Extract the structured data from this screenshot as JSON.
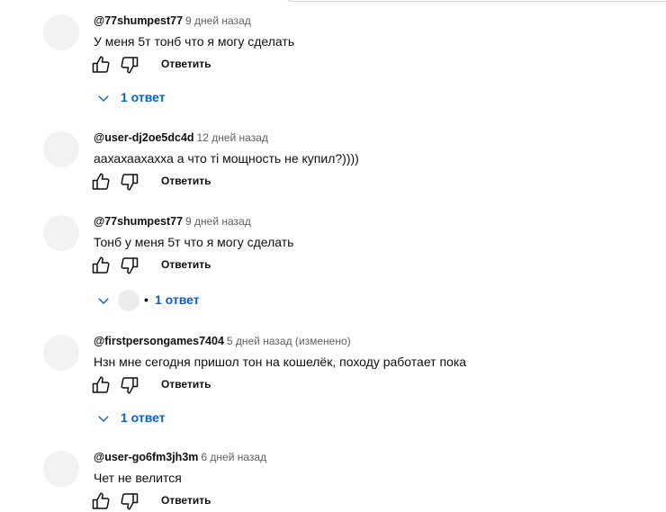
{
  "comments": [
    {
      "author": "@77shumpest77",
      "time": "9 дней назад",
      "text": "У меня 5т тонб что я могу сделать",
      "reply_label": "Ответить",
      "replies_label": "1 ответ"
    },
    {
      "author": "@user-dj2oe5dc4d",
      "time": "12 дней назад",
      "text": "аахахаахахха а что ті мощность не купил?))))",
      "reply_label": "Ответить"
    },
    {
      "author": "@77shumpest77",
      "time": "9 дней назад",
      "text": "Тонб у меня 5т что я могу сделать",
      "reply_label": "Ответить",
      "replies_separator": "•",
      "replies_label": "1 ответ"
    },
    {
      "author": "@firstpersongames7404",
      "time": "5 дней назад (изменено)",
      "text": "Нзн мне сегодня пришол тон на кошелёк, походу работает пока",
      "reply_label": "Ответить",
      "replies_label": "1 ответ"
    },
    {
      "author": "@user-go6fm3jh3m",
      "time": "6 дней назад",
      "text": "Чет не велится",
      "reply_label": "Ответить"
    }
  ],
  "colors": {
    "text": "#0f0f0f",
    "meta": "#606060",
    "link": "#065fd4",
    "avatar": "#f2f2f2"
  },
  "icons": {
    "like": "thumbs-up-icon",
    "dislike": "thumbs-down-icon",
    "expand": "chevron-down-icon"
  }
}
